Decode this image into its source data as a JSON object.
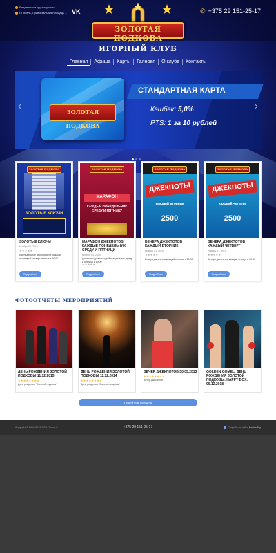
{
  "header": {
    "info_time": "Ежедневно и круглосуточно",
    "info_address": "г. Гомель, Привокзальная площадь 1",
    "vk_label": "VK",
    "phone": "+375 29 151-25-17",
    "logo_text": "ЗОЛОТАЯ ПОДКОВА",
    "club_title": "ИГОРНЫЙ КЛУБ"
  },
  "nav": [
    "Главная",
    "Афиша",
    "Карты",
    "Галерея",
    "О клубе",
    "Контакты"
  ],
  "slider": {
    "card_logo": "ЗОЛОТАЯ ПОДКОВА",
    "title": "СТАНДАРТНАЯ КАРТА",
    "cashback_label": "Кэшбэк:",
    "cashback_value": "5,0%",
    "pts_label": "PTS:",
    "pts_value": "1 за 10 рублей"
  },
  "cards": [
    {
      "poster_logo": "ЗОЛОТАЯ ПОДКОВА",
      "poster_head": "ЗОЛОТЫЕ КЛЮЧИ",
      "title": "ЗОЛОТЫЕ КЛЮЧИ",
      "date": "Ноябрь 04, 2019",
      "stars": "★★★★★",
      "text": "Еженедельное мероприятие каждый последний четверг месяца в 20:00",
      "button": "Подробнее"
    },
    {
      "poster_logo": "ЗОЛОТАЯ ПОДКОВА",
      "poster_head": "МАРАФОН",
      "poster_sub": "КАЖДЫЙ ПОНЕДЕЛЬНИК СРЕДУ И ПЯТНИЦУ",
      "title": "МАРАФОН ДЖЕКПОТОВ КАЖДЫЕ ПОНЕДЕЛЬНИК, СРЕДУ И ПЯТНИЦУ",
      "date": "Ноябрь 04, 2019",
      "stars": "★★★★★",
      "text": "Джекпотподкова каждый понедельник, среду и пятницу с 19:00",
      "button": "Подробнее"
    },
    {
      "poster_logo": "ЗОЛОТАЯ ПОДКОВА",
      "poster_head": "ДЖЕКПОТЫ",
      "poster_sub": "каждый вторник",
      "poster_amount": "2500",
      "title": "ВЕЧЕРА ДЖЕКПОТОВ КАЖДЫЙ ВТОРНИК",
      "date": "Ноябрь 01, 2019",
      "stars": "★★★★★",
      "text": "Вечера джекпотов каждый вторник в 20:00",
      "button": "Подробнее"
    },
    {
      "poster_logo": "ЗОЛОТАЯ ПОДКОВА",
      "poster_head": "ДЖЕКПОТЫ",
      "poster_sub": "каждый четверг",
      "poster_amount": "2500",
      "title": "ВЕЧЕРА ДЖЕКПОТОВ КАЖДЫЙ ЧЕТВЕРГ",
      "date": "Ноябрь 01, 2019",
      "stars": "★★★★★",
      "text": "Вечера джекпотов каждый четверг в 20:00",
      "button": "Подробнее"
    }
  ],
  "gallery": {
    "title": "ФОТООТЧЕТЫ МЕРОПРИЯТИЙ",
    "items": [
      {
        "title": "ДЕНЬ РОЖДЕНИЯ ЗОЛОТОЙ ПОДКОВЫ 11.12.2015",
        "stars": "★★★★★★★★",
        "text": "День рождения \"Золотой подковы\""
      },
      {
        "title": "ДЕНЬ РОЖДЕНИЯ ЗОЛОТОЙ ПОДКОВЫ 11.12.2014",
        "stars": "★★★★★★★★",
        "text": "День рождения \"Золотой подковы\""
      },
      {
        "title": "ВЕЧЕР ДЖЕКПОТОВ 30.05.2013",
        "stars": "★★★★★★★★",
        "text": "Вечер джекпотов"
      },
      {
        "title": "GOLDEN GOMEL. ДЕНЬ РОЖДЕНИЯ ЗОЛОТОЙ ПОДКОВЫ. HAPPY BOX. 06.12.2018",
        "stars": "",
        "text": ""
      }
    ],
    "button": "Перейти в галерею"
  },
  "footer": {
    "copyright": "Copyright © 2017-2019 ООО \"Золото\"",
    "phone": "+375 29 151-25-17",
    "dev_prefix": "Разработка сайта",
    "dev_link": "ZodiacCity"
  },
  "colors": {
    "accent_blue": "#5b8fe0",
    "section_title": "#2c4d8f",
    "logo_red": "#d22a22",
    "logo_gold": "#ffd966"
  }
}
